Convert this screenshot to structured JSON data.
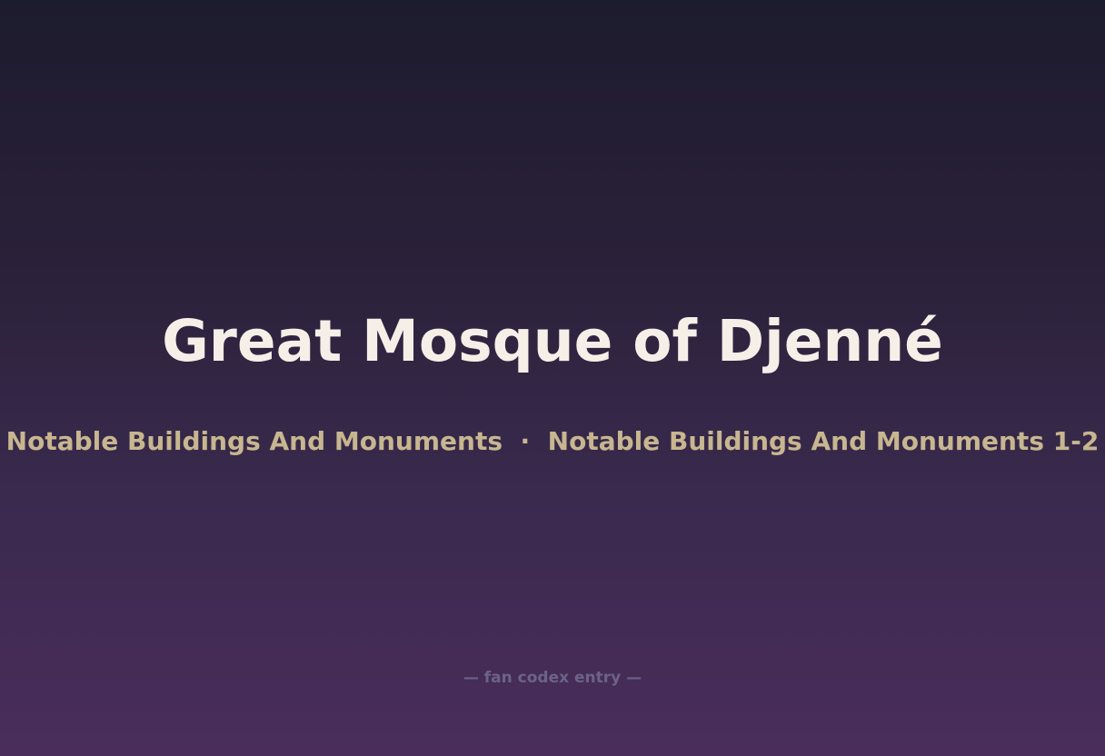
{
  "title": "Great Mosque of Djenné",
  "subtitle": "Notable Buildings And Monuments  ·  Notable Buildings And Monuments 1-2",
  "footer": "— fan codex entry —"
}
